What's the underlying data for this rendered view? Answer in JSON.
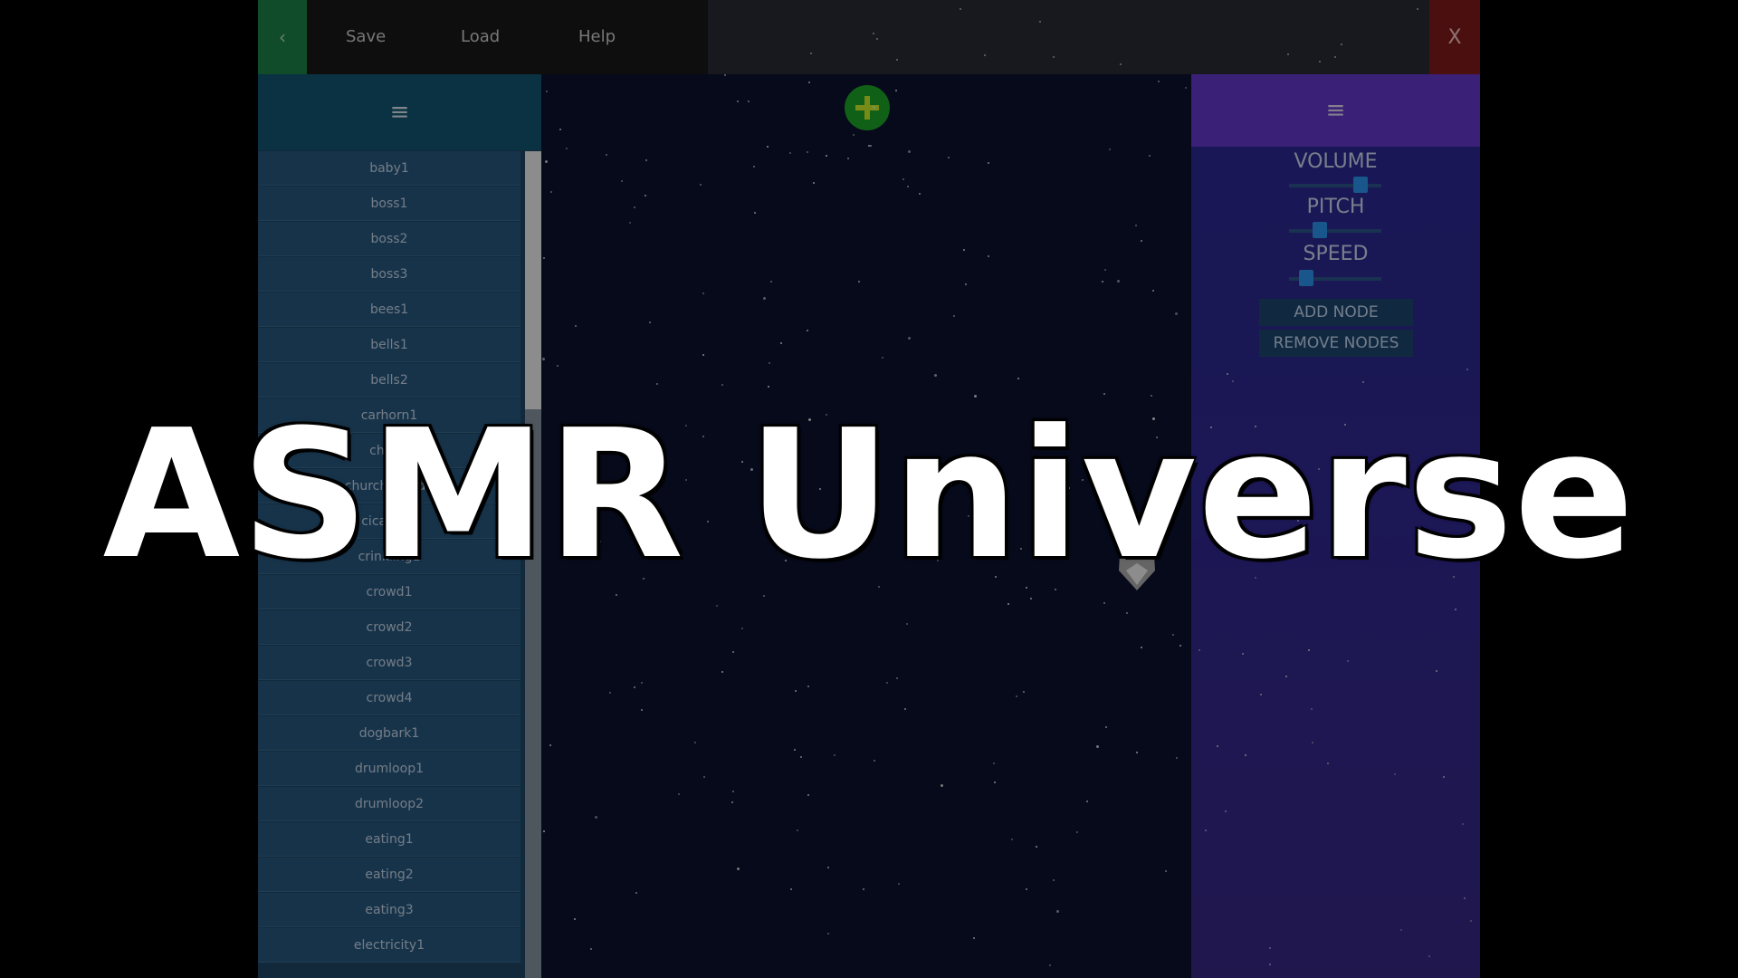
{
  "topbar": {
    "back_label": "‹",
    "menu": [
      "Save",
      "Load",
      "Help"
    ],
    "close_label": "X"
  },
  "left_panel": {
    "header_icon": "≡",
    "sounds": [
      "baby1",
      "boss1",
      "boss2",
      "boss3",
      "bees1",
      "bells1",
      "bells2",
      "carhorn1",
      "choir1",
      "churchcrowd1",
      "cicadas1",
      "crinkling1",
      "crowd1",
      "crowd2",
      "crowd3",
      "crowd4",
      "dogbark1",
      "drumloop1",
      "drumloop2",
      "eating1",
      "eating2",
      "eating3",
      "electricity1"
    ],
    "scroll_position": 0.0
  },
  "center": {
    "add_icon": "plus-circle-icon"
  },
  "right_panel": {
    "header_icon": "≡",
    "volume_label": "VOLUME",
    "pitch_label": "PITCH",
    "speed_label": "SPEED",
    "volume_value": 0.83,
    "pitch_value": 0.3,
    "speed_value": 0.13,
    "add_node_label": "ADD NODE",
    "remove_nodes_label": "REMOVE NODES"
  },
  "overlay": {
    "title": "ASMR Universe"
  },
  "colors": {
    "back": "#1f8a4c",
    "close": "#8a1b1b",
    "left_header": "#135a78",
    "right_header": "#6a3ad6",
    "add_button": "#1faf2a"
  }
}
